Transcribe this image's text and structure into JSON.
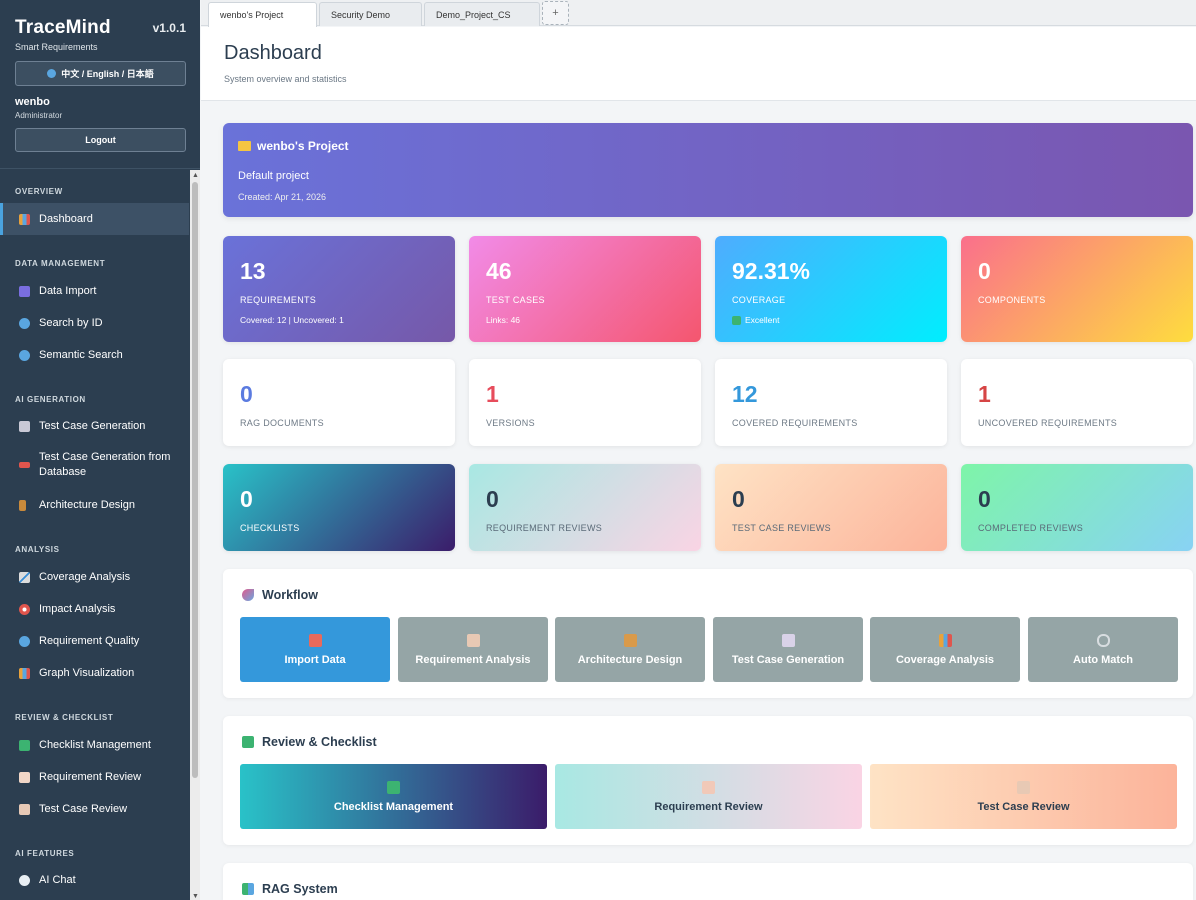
{
  "sidebar": {
    "brand": "TraceMind",
    "version": "v1.0.1",
    "tagline": "Smart Requirements",
    "language_button": "中文 / English / 日本語",
    "user": {
      "name": "wenbo",
      "role": "Administrator"
    },
    "logout_label": "Logout",
    "sections": [
      {
        "title": "OVERVIEW",
        "items": [
          {
            "label": "Dashboard",
            "icon": "bar-chart-icon"
          }
        ]
      },
      {
        "title": "DATA MANAGEMENT",
        "items": [
          {
            "label": "Data Import",
            "icon": "inbox-icon"
          },
          {
            "label": "Search by ID",
            "icon": "magnifier-icon"
          },
          {
            "label": "Semantic Search",
            "icon": "magnifier-right-icon"
          }
        ]
      },
      {
        "title": "AI GENERATION",
        "items": [
          {
            "label": "Test Case Generation",
            "icon": "robot-icon"
          },
          {
            "label": "Test Case Generation from Database",
            "icon": "car-icon"
          },
          {
            "label": "Architecture Design",
            "icon": "building-icon"
          }
        ]
      },
      {
        "title": "ANALYSIS",
        "items": [
          {
            "label": "Coverage Analysis",
            "icon": "chart-up-icon"
          },
          {
            "label": "Impact Analysis",
            "icon": "target-icon"
          },
          {
            "label": "Requirement Quality",
            "icon": "magnifier-icon"
          },
          {
            "label": "Graph Visualization",
            "icon": "bar-chart-icon"
          }
        ]
      },
      {
        "title": "REVIEW & CHECKLIST",
        "items": [
          {
            "label": "Checklist Management",
            "icon": "check-box-icon"
          },
          {
            "label": "Requirement Review",
            "icon": "memo-icon"
          },
          {
            "label": "Test Case Review",
            "icon": "clipboard-icon"
          }
        ]
      },
      {
        "title": "AI FEATURES",
        "items": [
          {
            "label": "AI Chat",
            "icon": "speech-bubble-icon"
          }
        ]
      }
    ]
  },
  "tabs": [
    {
      "label": "wenbo's Project",
      "active": true
    },
    {
      "label": "Security Demo",
      "active": false
    },
    {
      "label": "Demo_Project_CS",
      "active": false
    }
  ],
  "tab_add_label": "+",
  "header": {
    "title": "Dashboard",
    "subtitle": "System overview and statistics"
  },
  "project": {
    "name": "wenbo's Project",
    "description": "Default project",
    "created": "Created: Apr 21, 2026"
  },
  "stats_primary": [
    {
      "value": "13",
      "label": "REQUIREMENTS",
      "sub": "Covered: 12 | Uncovered: 1"
    },
    {
      "value": "46",
      "label": "TEST CASES",
      "sub": "Links: 46"
    },
    {
      "value": "92.31%",
      "label": "COVERAGE",
      "sub": "Excellent"
    },
    {
      "value": "0",
      "label": "COMPONENTS",
      "sub": ""
    }
  ],
  "stats_secondary": [
    {
      "value": "0",
      "label": "RAG DOCUMENTS",
      "color": "#5b7be0"
    },
    {
      "value": "1",
      "label": "VERSIONS",
      "color": "#e74c5c"
    },
    {
      "value": "12",
      "label": "COVERED REQUIREMENTS",
      "color": "#3498db"
    },
    {
      "value": "1",
      "label": "UNCOVERED REQUIREMENTS",
      "color": "#d64545"
    }
  ],
  "stats_review": [
    {
      "value": "0",
      "label": "CHECKLISTS"
    },
    {
      "value": "0",
      "label": "REQUIREMENT REVIEWS"
    },
    {
      "value": "0",
      "label": "TEST CASE REVIEWS"
    },
    {
      "value": "0",
      "label": "COMPLETED REVIEWS"
    }
  ],
  "workflow": {
    "title": "Workflow",
    "buttons": [
      {
        "label": "Import Data",
        "icon": "inbox-icon"
      },
      {
        "label": "Requirement Analysis",
        "icon": "clipboard-icon"
      },
      {
        "label": "Architecture Design",
        "icon": "building-icon"
      },
      {
        "label": "Test Case Generation",
        "icon": "robot-icon"
      },
      {
        "label": "Coverage Analysis",
        "icon": "bar-chart-icon"
      },
      {
        "label": "Auto Match",
        "icon": "link-icon"
      }
    ]
  },
  "review": {
    "title": "Review & Checklist",
    "buttons": [
      {
        "label": "Checklist Management",
        "icon": "check-box-icon"
      },
      {
        "label": "Requirement Review",
        "icon": "memo-icon"
      },
      {
        "label": "Test Case Review",
        "icon": "clipboard-icon"
      }
    ]
  },
  "rag": {
    "title": "RAG System"
  },
  "colors": {
    "sidebar_bg": "#2c3e50",
    "accent": "#3498db",
    "workflow_gray": "#95a5a6"
  }
}
